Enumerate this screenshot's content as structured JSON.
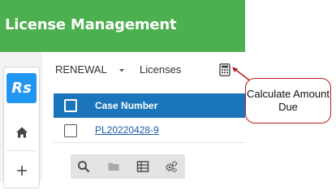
{
  "header": {
    "title": "License Management",
    "color": "#4caf50"
  },
  "sidebar": {
    "logo": "Rs",
    "items": [
      {
        "icon": "home-icon"
      },
      {
        "icon": "plus-icon"
      }
    ]
  },
  "breadcrumb": {
    "module": "RENEWAL",
    "separator_icon": "caret-down-icon",
    "section": "Licenses"
  },
  "table": {
    "header_color": "#1a75bb",
    "columns": [
      "Case Number"
    ],
    "rows": [
      {
        "case_number": "PL20220428-9"
      }
    ]
  },
  "toolbar": {
    "icons": [
      "search-icon",
      "folder-icon",
      "table-icon",
      "settings-gears-icon"
    ]
  },
  "callout": {
    "text": "Calculate Amount Due",
    "border_color": "#b71c1c"
  }
}
